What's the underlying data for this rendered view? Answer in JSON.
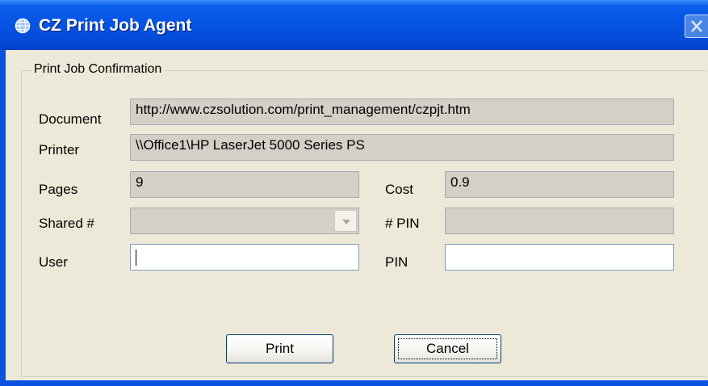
{
  "window": {
    "title": "CZ Print Job Agent",
    "icon": "app-globe-icon",
    "close_icon": "close-icon"
  },
  "group": {
    "legend": "Print Job Confirmation"
  },
  "fields": {
    "document": {
      "label": "Document",
      "value": "http://www.czsolution.com/print_management/czpjt.htm"
    },
    "printer": {
      "label": "Printer",
      "value": "\\\\Office1\\HP LaserJet 5000 Series PS"
    },
    "pages": {
      "label": "Pages",
      "value": "9"
    },
    "cost": {
      "label": "Cost",
      "value": "0.9"
    },
    "shared": {
      "label": "Shared #",
      "value": ""
    },
    "pin_number": {
      "label": "# PIN",
      "value": ""
    },
    "user": {
      "label": "User",
      "value": ""
    },
    "pin": {
      "label": "PIN",
      "value": ""
    }
  },
  "buttons": {
    "print": "Print",
    "cancel": "Cancel"
  },
  "colors": {
    "titlebar": "#0553e3",
    "client": "#ece9d8",
    "readonly_field": "#d4d0c8"
  }
}
